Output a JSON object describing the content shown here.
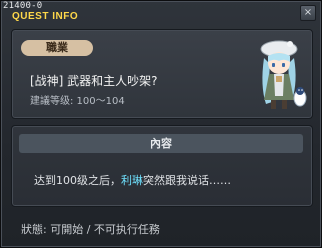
{
  "header": {
    "quest_id": "21400-0",
    "title": "QUEST INFO",
    "close_label": "×"
  },
  "quest": {
    "category": "職業",
    "name": "[战神] 武器和主人吵架?",
    "level": "建議等级: 100～104",
    "npc_icon": "npc-portrait-icon"
  },
  "content": {
    "header": "內容",
    "text_before": "达到100级之后，",
    "npc_name": "利琳",
    "text_after": "突然跟我说话……",
    "colors": {
      "npc_name": "#6fe2ff"
    }
  },
  "status": {
    "text": "狀態:  可開始  /  不可执行任務"
  },
  "colors": {
    "title": "#ffd84a",
    "badge": "#d6c0a3",
    "panel": "#3b4048"
  }
}
